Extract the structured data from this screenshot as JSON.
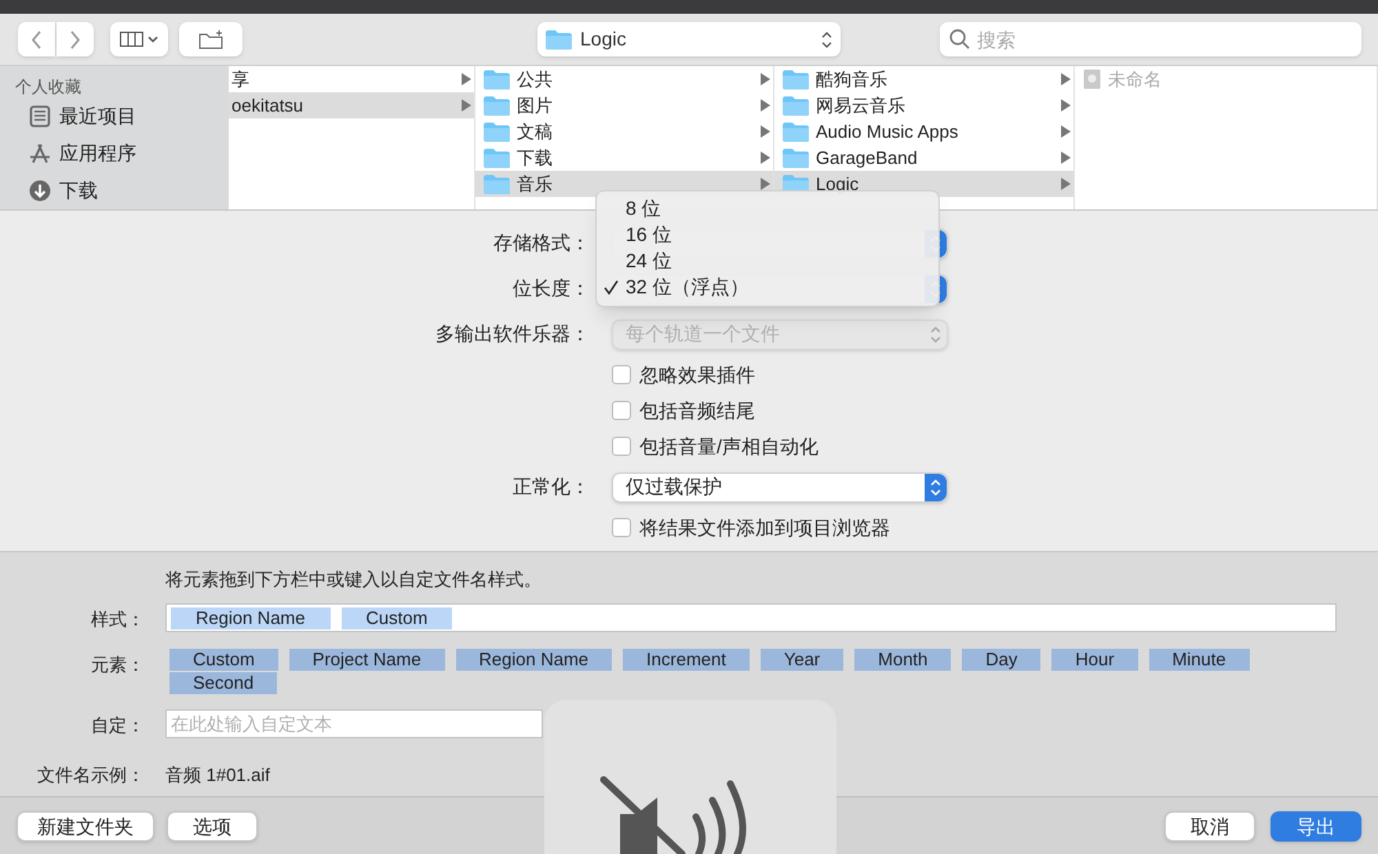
{
  "toolbar": {
    "path": "Logic",
    "search_placeholder": "搜索"
  },
  "sidebar": {
    "heading": "个人收藏",
    "items": [
      {
        "label": "最近项目",
        "kind": "recent"
      },
      {
        "label": "应用程序",
        "kind": "apps"
      },
      {
        "label": "下载",
        "kind": "downloads"
      }
    ]
  },
  "browser": {
    "columns": [
      [
        {
          "label": "享",
          "kind": "text",
          "selected": false
        },
        {
          "label": "oekitatsu",
          "kind": "text",
          "selected": true
        }
      ],
      [
        {
          "label": "公共",
          "kind": "folder",
          "selected": false
        },
        {
          "label": "图片",
          "kind": "folder",
          "selected": false
        },
        {
          "label": "文稿",
          "kind": "folder",
          "selected": false
        },
        {
          "label": "下载",
          "kind": "folder",
          "selected": false
        },
        {
          "label": "音乐",
          "kind": "folder",
          "selected": true
        }
      ],
      [
        {
          "label": "酷狗音乐",
          "kind": "folder",
          "selected": false
        },
        {
          "label": "网易云音乐",
          "kind": "folder",
          "selected": false
        },
        {
          "label": "Audio Music Apps",
          "kind": "folder",
          "selected": false
        },
        {
          "label": "GarageBand",
          "kind": "folder",
          "selected": false
        },
        {
          "label": "Logic",
          "kind": "folder",
          "selected": true
        }
      ],
      [
        {
          "label": "未命名",
          "kind": "file",
          "selected": false
        }
      ]
    ]
  },
  "options": [
    {
      "kind": "popup",
      "label": "存储格式：",
      "disabled": false
    },
    {
      "kind": "popup",
      "label": "位长度：",
      "disabled": false
    },
    {
      "kind": "popup",
      "label": "多输出软件乐器：",
      "value": "每个轨道一个文件",
      "disabled": true
    },
    {
      "kind": "checkbox",
      "label": "忽略效果插件",
      "checked": false
    },
    {
      "kind": "checkbox",
      "label": "包括音频结尾",
      "checked": false
    },
    {
      "kind": "checkbox",
      "label": "包括音量/声相自动化",
      "checked": false
    },
    {
      "kind": "popup",
      "label": "正常化：",
      "value": "仅过载保护",
      "disabled": false
    },
    {
      "kind": "checkbox",
      "label": "将结果文件添加到项目浏览器",
      "checked": false
    }
  ],
  "menu": {
    "items": [
      {
        "label": "8 位",
        "checked": false
      },
      {
        "label": "16 位",
        "checked": false
      },
      {
        "label": "24 位",
        "checked": false
      },
      {
        "label": "32 位（浮点）",
        "checked": true
      }
    ]
  },
  "naming": {
    "hint": "将元素拖到下方栏中或键入以自定文件名样式。",
    "style_label": "样式：",
    "style_tokens": [
      "Region Name",
      "Custom"
    ],
    "elements_label": "元素：",
    "elements": [
      "Custom",
      "Project Name",
      "Region Name",
      "Increment",
      "Year",
      "Month",
      "Day",
      "Hour",
      "Minute",
      "Second"
    ],
    "custom_label": "自定：",
    "custom_placeholder": "在此处输入自定文本",
    "example_label": "文件名示例：",
    "example": "音频 1#01.aif"
  },
  "buttons": [
    {
      "label": "新建文件夹",
      "kind": "plain"
    },
    {
      "label": "选项",
      "kind": "plain"
    },
    {
      "label": "取消",
      "kind": "plain"
    },
    {
      "label": "导出",
      "kind": "primary"
    }
  ]
}
